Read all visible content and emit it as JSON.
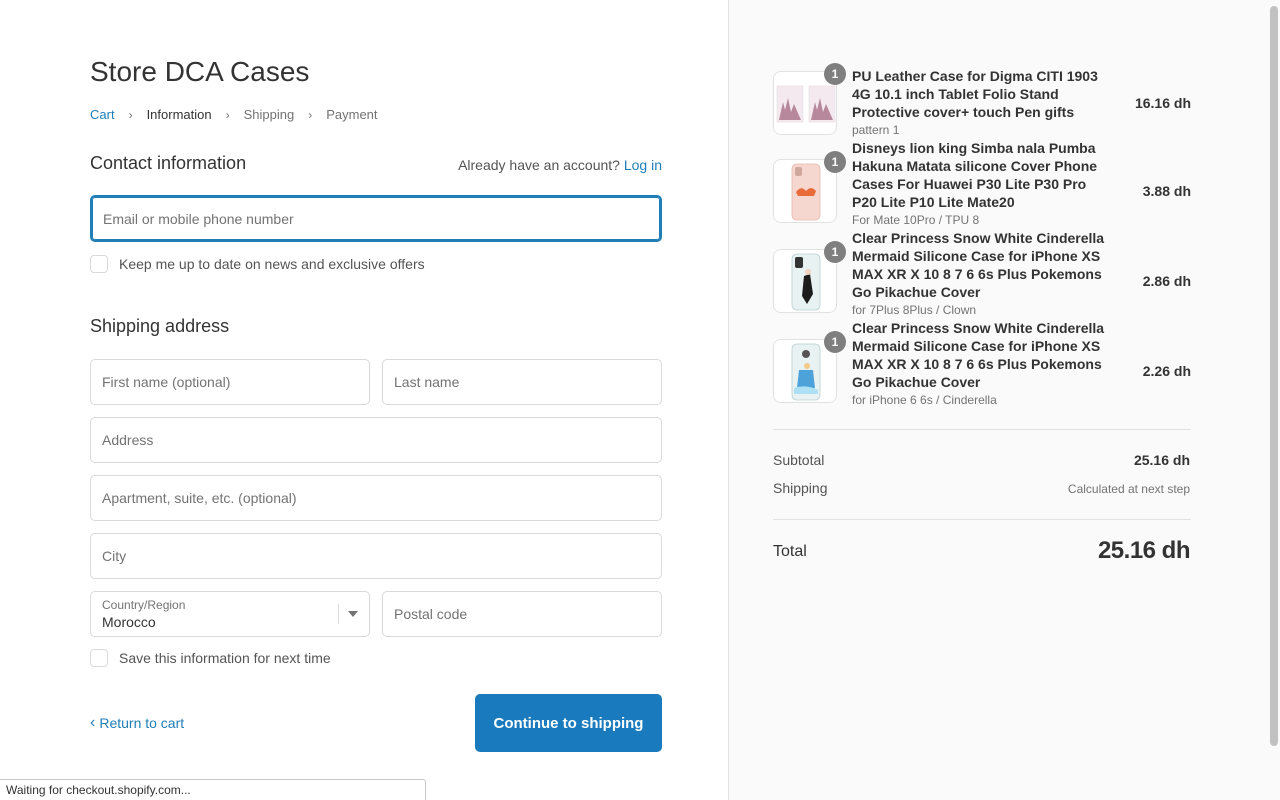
{
  "store": {
    "title": "Store DCA Cases"
  },
  "breadcrumb": [
    {
      "label": "Cart"
    },
    {
      "label": "Information"
    },
    {
      "label": "Shipping"
    },
    {
      "label": "Payment"
    }
  ],
  "contact": {
    "title": "Contact information",
    "account_prompt": "Already have an account?",
    "login_label": "Log in",
    "email_placeholder": "Email or mobile phone number",
    "newsletter_label": "Keep me up to date on news and exclusive offers"
  },
  "shipping": {
    "title": "Shipping address",
    "first_name_placeholder": "First name (optional)",
    "last_name_placeholder": "Last name",
    "address_placeholder": "Address",
    "apartment_placeholder": "Apartment, suite, etc. (optional)",
    "city_placeholder": "City",
    "country_label": "Country/Region",
    "country_value": "Morocco",
    "postal_placeholder": "Postal code",
    "save_info_label": "Save this information for next time"
  },
  "actions": {
    "return_label": "Return to cart",
    "continue_label": "Continue to shipping"
  },
  "status_bar": {
    "text": "Waiting for checkout.shopify.com..."
  },
  "order": {
    "items": [
      {
        "quantity": "1",
        "name": "PU Leather Case for Digma CITI 1903 4G 10.1 inch Tablet Folio Stand Protective cover+ touch Pen gifts",
        "variant": "pattern 1",
        "price": "16.16 dh"
      },
      {
        "quantity": "1",
        "name": "Disneys lion king Simba nala Pumba Hakuna Matata silicone Cover Phone Cases For Huawei P30 Lite P30 Pro P20 Lite P10 Lite Mate20",
        "variant": "For Mate 10Pro / TPU 8",
        "price": "3.88 dh"
      },
      {
        "quantity": "1",
        "name": "Clear Princess Snow White Cinderella Mermaid Silicone Case for iPhone XS MAX XR X 10 8 7 6 6s Plus Pokemons Go Pikachue Cover",
        "variant": "for 7Plus 8Plus / Clown",
        "price": "2.86 dh"
      },
      {
        "quantity": "1",
        "name": "Clear Princess Snow White Cinderella Mermaid Silicone Case for iPhone XS MAX XR X 10 8 7 6 6s Plus Pokemons Go Pikachue Cover",
        "variant": "for iPhone 6 6s / Cinderella",
        "price": "2.26 dh"
      }
    ],
    "subtotal_label": "Subtotal",
    "subtotal_value": "25.16 dh",
    "shipping_label": "Shipping",
    "shipping_value": "Calculated at next step",
    "total_label": "Total",
    "total_value": "25.16 dh"
  },
  "colors": {
    "accent": "#197bbd",
    "link": "#1f7eb8",
    "sidebar_bg": "#fafafa"
  }
}
